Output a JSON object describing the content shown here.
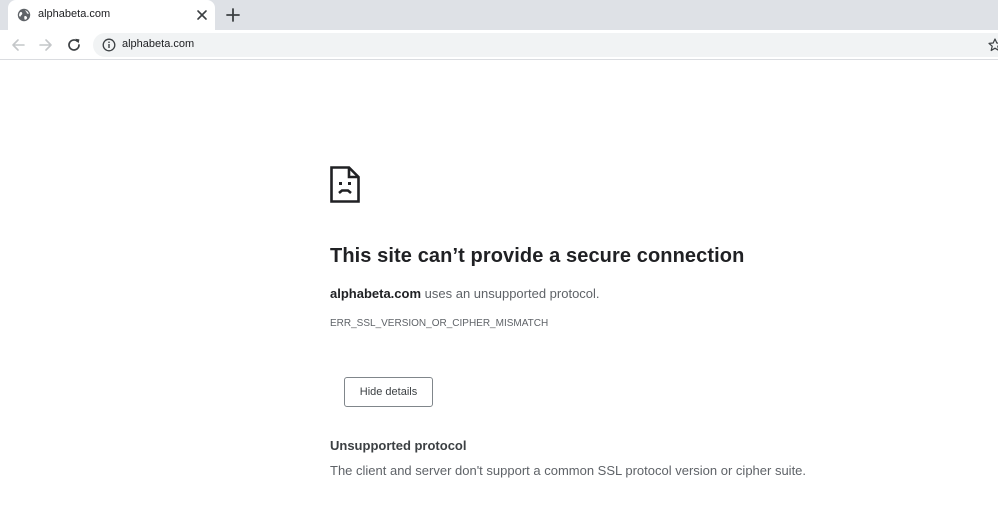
{
  "tab": {
    "title": "alphabeta.com",
    "favicon": "globe-icon",
    "close_icon": "close-icon"
  },
  "new_tab_icon": "plus-icon",
  "toolbar": {
    "back_icon": "back-arrow-icon",
    "forward_icon": "forward-arrow-icon",
    "reload_icon": "reload-icon",
    "site_info_icon": "info-icon",
    "url": "alphabeta.com",
    "bookmark_icon": "star-icon"
  },
  "error": {
    "icon": "sad-document-icon",
    "title": "This site can’t provide a secure connection",
    "host": "alphabeta.com",
    "description_suffix": " uses an unsupported protocol.",
    "code": "ERR_SSL_VERSION_OR_CIPHER_MISMATCH",
    "details_button_label": "Hide details",
    "details_heading": "Unsupported protocol",
    "details_text": "The client and server don't support a common SSL protocol version or cipher suite."
  },
  "colors": {
    "tabstrip": "#dee1e6",
    "omnibox": "#f1f3f4",
    "text_primary": "#202124",
    "text_secondary": "#5f6368"
  }
}
